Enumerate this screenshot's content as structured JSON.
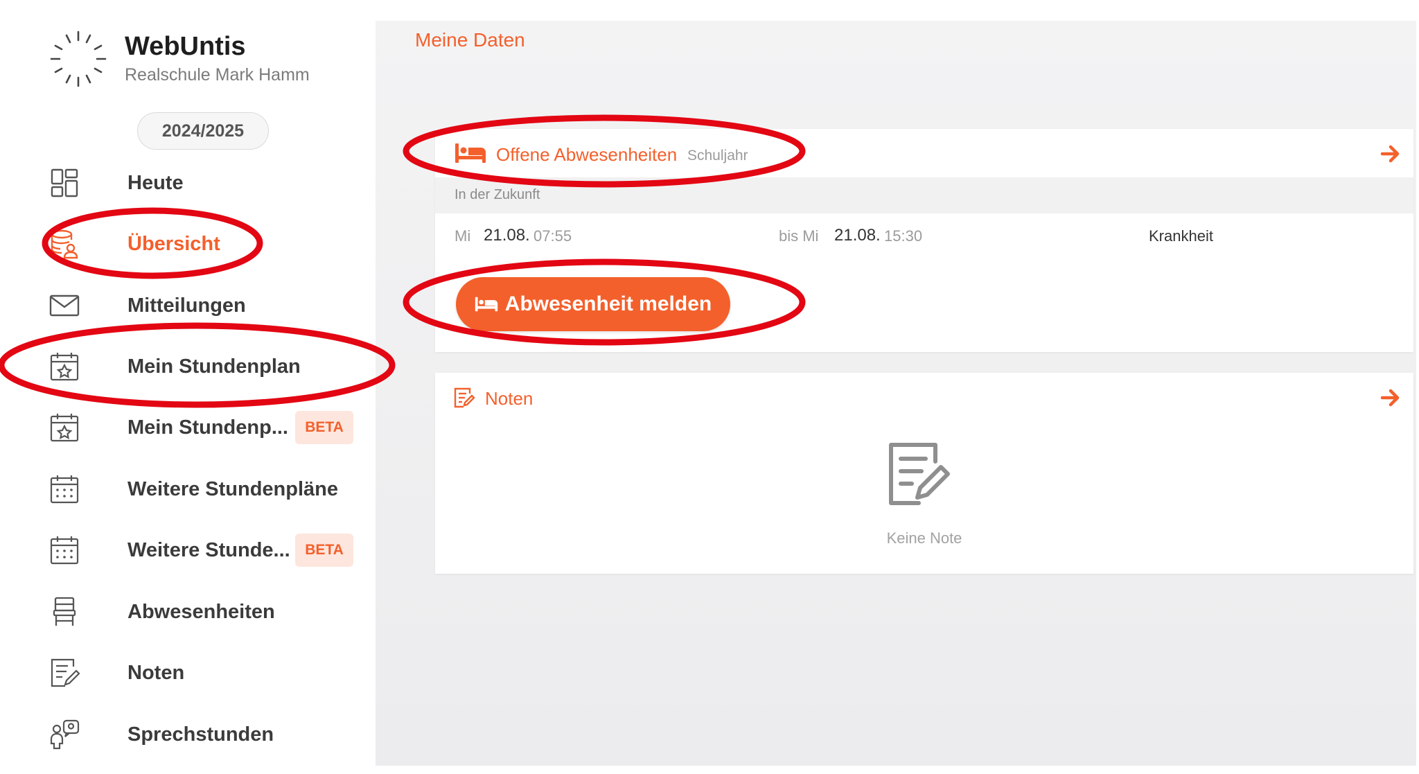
{
  "app": {
    "name": "WebUntis",
    "school": "Realschule Mark Hamm",
    "school_year": "2024/2025"
  },
  "sidebar": {
    "items": [
      {
        "label": "Heute",
        "icon": "dashboard-icon",
        "active": false
      },
      {
        "label": "Übersicht",
        "icon": "profile-data-icon",
        "active": true
      },
      {
        "label": "Mitteilungen",
        "icon": "envelope-icon",
        "active": false
      },
      {
        "label": "Mein Stundenplan",
        "icon": "calendar-star-icon",
        "active": false
      },
      {
        "label": "Mein Stundenp...",
        "icon": "calendar-star-icon",
        "active": false,
        "badge": "BETA"
      },
      {
        "label": "Weitere Stundenpläne",
        "icon": "calendar-grid-icon",
        "active": false
      },
      {
        "label": "Weitere Stunde...",
        "icon": "calendar-grid-icon",
        "active": false,
        "badge": "BETA"
      },
      {
        "label": "Abwesenheiten",
        "icon": "chair-icon",
        "active": false
      },
      {
        "label": "Noten",
        "icon": "grades-icon",
        "active": false
      },
      {
        "label": "Sprechstunden",
        "icon": "consultation-icon",
        "active": false
      }
    ]
  },
  "main": {
    "title": "Meine Daten",
    "absences_card": {
      "title": "Offene Abwesenheiten",
      "subtitle": "Schuljahr",
      "section": "In der Zukunft",
      "row": {
        "from_day": "Mi",
        "from_date": "21.08.",
        "from_time": "07:55",
        "to_prefix": "bis Mi",
        "to_date": "21.08.",
        "to_time": "15:30",
        "reason": "Krankheit"
      },
      "button": "Abwesenheit melden"
    },
    "grades_card": {
      "title": "Noten",
      "empty_text": "Keine Note"
    }
  },
  "colors": {
    "accent": "#f3602c",
    "annotation": "#e30613",
    "text": "#3b3b3b",
    "muted": "#9b9b9b"
  }
}
